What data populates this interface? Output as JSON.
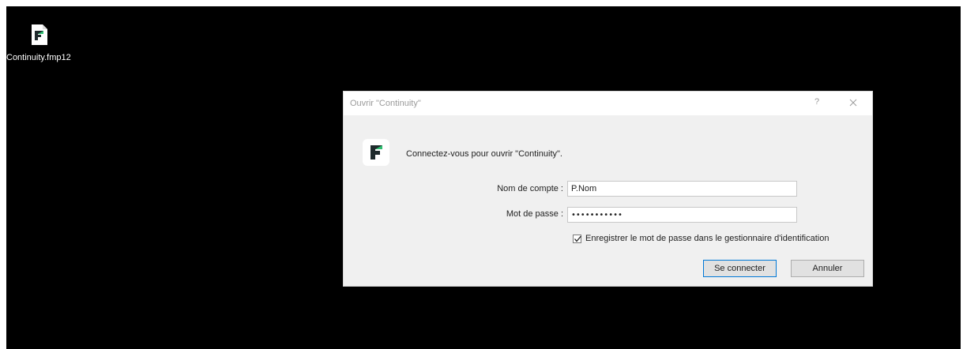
{
  "desktop": {
    "icon_name": "Continuity.fmp12"
  },
  "dialog": {
    "title": "Ouvrir \"Continuity\"",
    "help": "?",
    "prompt": "Connectez-vous pour ouvrir \"Continuity\".",
    "account_label": "Nom de compte :",
    "account_value": "P.Nom",
    "password_label": "Mot de passe :",
    "password_value": "•••••••••••",
    "remember_label": "Enregistrer le mot de passe dans le gestionnaire d'identification",
    "remember_checked": true,
    "connect_button": "Se connecter",
    "cancel_button": "Annuler"
  },
  "colors": {
    "desktop_bg": "#000000",
    "dialog_bg": "#f0f0f0",
    "brand_green": "#2fbf71",
    "brand_dark": "#1f2a2c",
    "focus_blue": "#0078d7"
  },
  "icons": {
    "file": "filemaker-file-icon",
    "app": "filemaker-app-icon",
    "close": "close-icon",
    "check": "checkmark-icon"
  }
}
